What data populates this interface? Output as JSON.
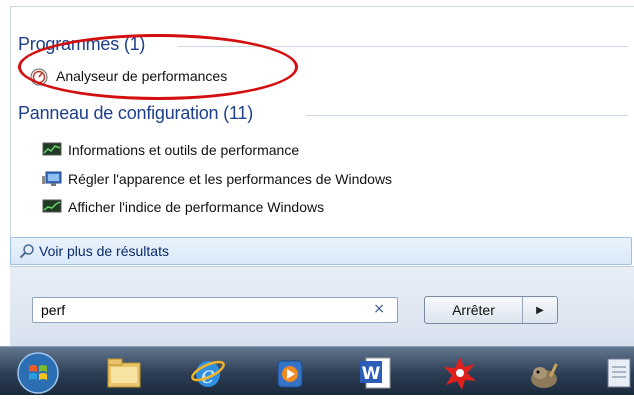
{
  "programs": {
    "header": "Programmes (1)",
    "items": [
      {
        "label": "Analyseur de performances",
        "icon": "performance-monitor-icon"
      }
    ]
  },
  "control_panel": {
    "header": "Panneau de configuration (11)",
    "items": [
      {
        "label": "Informations et outils de performance",
        "icon": "performance-info-icon"
      },
      {
        "label": "Régler l'apparence et les performances de Windows",
        "icon": "display-settings-icon"
      },
      {
        "label": "Afficher l'indice de performance Windows",
        "icon": "performance-index-icon"
      }
    ]
  },
  "see_more": {
    "label": "Voir plus de résultats",
    "icon": "search-icon"
  },
  "search": {
    "value": "perf",
    "clear_icon": "×"
  },
  "shutdown": {
    "label": "Arrêter",
    "arrow": "▶"
  },
  "taskbar": {
    "items": [
      {
        "name": "start-orb-icon"
      },
      {
        "name": "file-explorer-icon"
      },
      {
        "name": "internet-explorer-icon"
      },
      {
        "name": "media-player-icon"
      },
      {
        "name": "word-icon"
      },
      {
        "name": "red-splash-app-icon"
      },
      {
        "name": "gimp-icon"
      },
      {
        "name": "notepad-icon"
      }
    ]
  },
  "colors": {
    "header": "#1e3f8c",
    "annotation_ellipse": "#d40f0f",
    "see_more_bg": "#d9e8f8"
  }
}
